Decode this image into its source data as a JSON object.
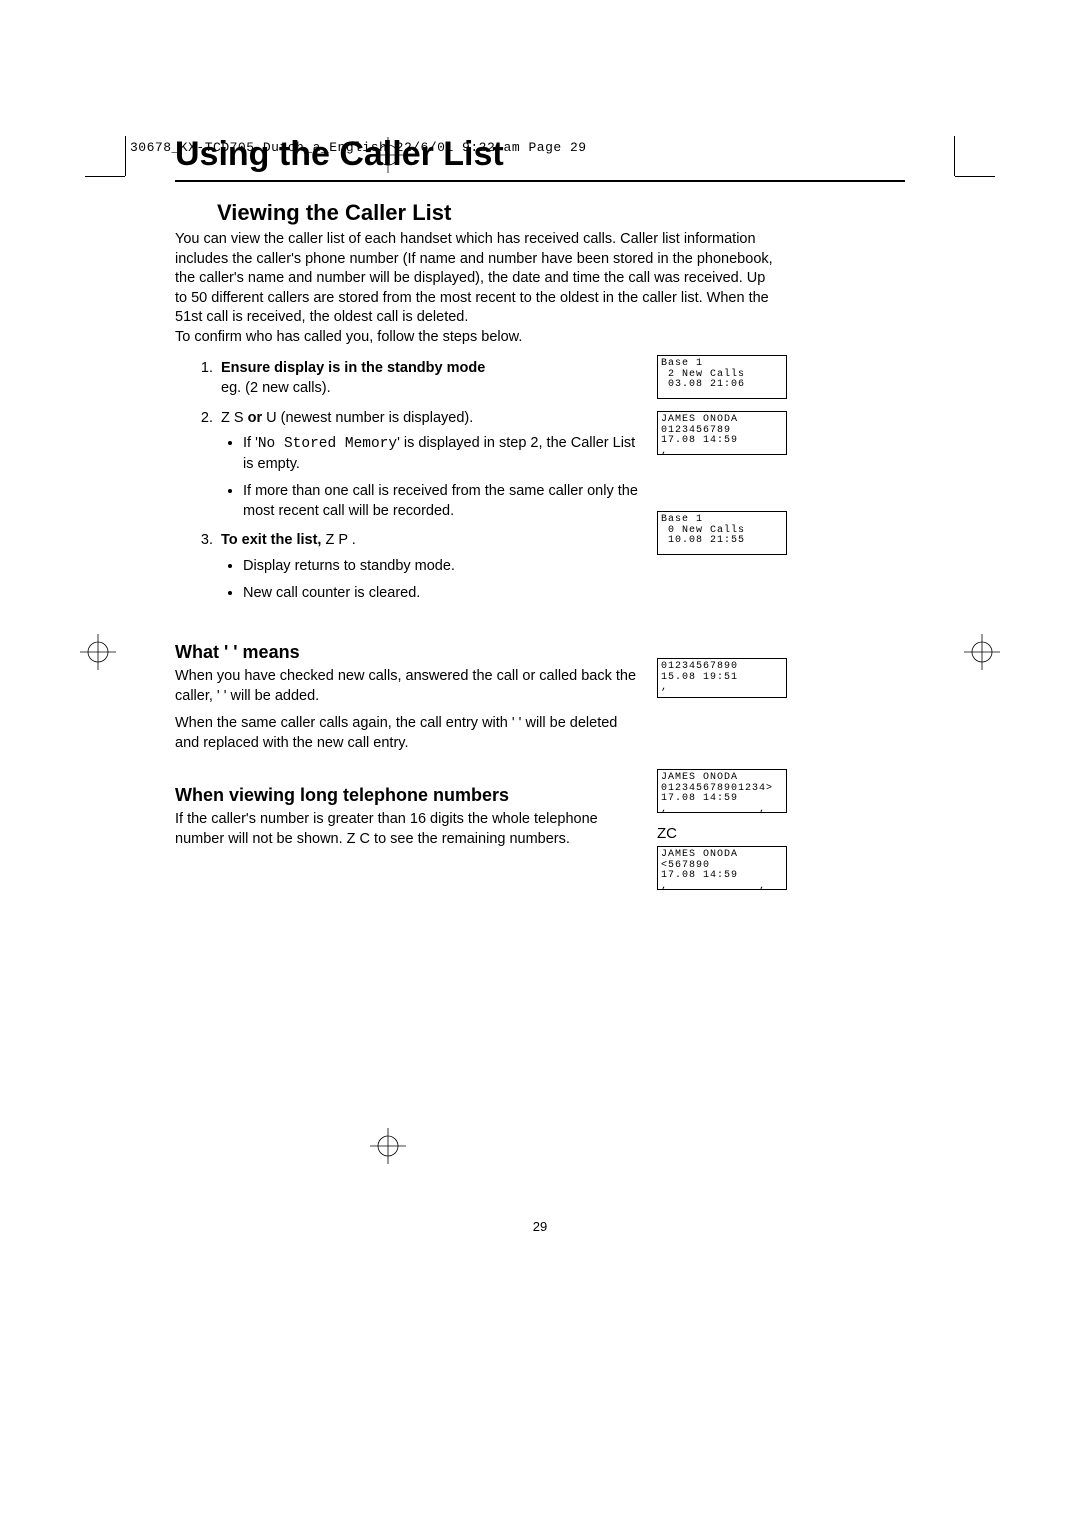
{
  "print_header": "30678_KX-TCD705 Dutch_a_English  22/6/01  9:22 am  Page 29",
  "title": "Using the Caller List",
  "section1": {
    "heading": "Viewing the Caller List",
    "para": "You can view the caller list of each handset which has received calls. Caller list information includes the caller's phone number (If name and number have been stored in the phonebook, the caller's name and number will be displayed), the date and time the call was received. Up to 50 different callers are stored from the most recent to the oldest in the caller list. When the 51st call is received, the oldest call is deleted.\nTo confirm who has called you, follow the steps below.",
    "step1_bold": "Ensure display is in the standby mode",
    "step1_sub": "eg. (2 new calls).",
    "step2_lead": "Z S",
    "step2_or": " or ",
    "step2_tail": "U   (newest number is displayed).",
    "step2_bullet1a": "If '",
    "step2_nostored": "No Stored Memory",
    "step2_bullet1b": "' is displayed in step 2, the Caller List is empty.",
    "step2_bullet2": "If more than one call is received from the same caller only the most recent call will be recorded.",
    "step3_bold": "To exit the list,",
    "step3_tail": " Z P       .",
    "step3_bullet1": "Display returns to standby mode.",
    "step3_bullet2": "New call counter is cleared."
  },
  "section2": {
    "heading": "What '   ' means",
    "para1": "When you have checked new calls, answered the call or called back the caller, '   ' will be added.",
    "para2": "When the same caller calls again, the call entry with '   ' will be deleted and replaced with the new call entry."
  },
  "section3": {
    "heading": "When viewing long telephone numbers",
    "para_a": "If the caller's number is greater than 16 digits the whole telephone number will not be shown. Z C          to see the remaining numbers."
  },
  "zc_label": "ZC",
  "lcd": {
    "a": "Base 1\n 2 New Calls\n 03.08 21:06",
    "b": "JAMES ONODA\n0123456789\n17.08 14:59\n,",
    "c": "Base 1\n 0 New Calls\n 10.08 21:55",
    "d": "01234567890\n15.08 19:51\n,",
    "e": "JAMES ONODA\n012345678901234>\n17.08 14:59\n,             ,",
    "f": "JAMES ONODA\n<567890\n17.08 14:59\n,             ,"
  },
  "page_number": "29"
}
